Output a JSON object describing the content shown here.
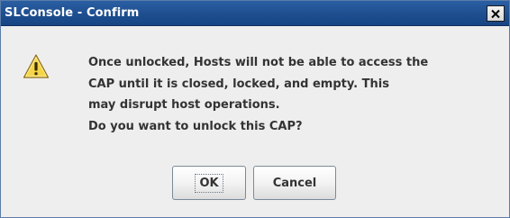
{
  "window": {
    "title": "SLConsole - Confirm",
    "close_icon": "close-icon"
  },
  "dialog": {
    "icon": "warning-icon",
    "message_lines": [
      "Once unlocked, Hosts will not be able to access the",
      "CAP until it is closed, locked, and empty. This",
      "may disrupt host operations.",
      "Do you want to unlock this CAP?"
    ],
    "ok_label": "OK",
    "cancel_label": "Cancel"
  },
  "colors": {
    "titlebar": "#1e4e8f",
    "title_text": "#ffffff",
    "body_bg": "#eeeeee",
    "text": "#333333",
    "warning_fill": "#f5d547"
  }
}
